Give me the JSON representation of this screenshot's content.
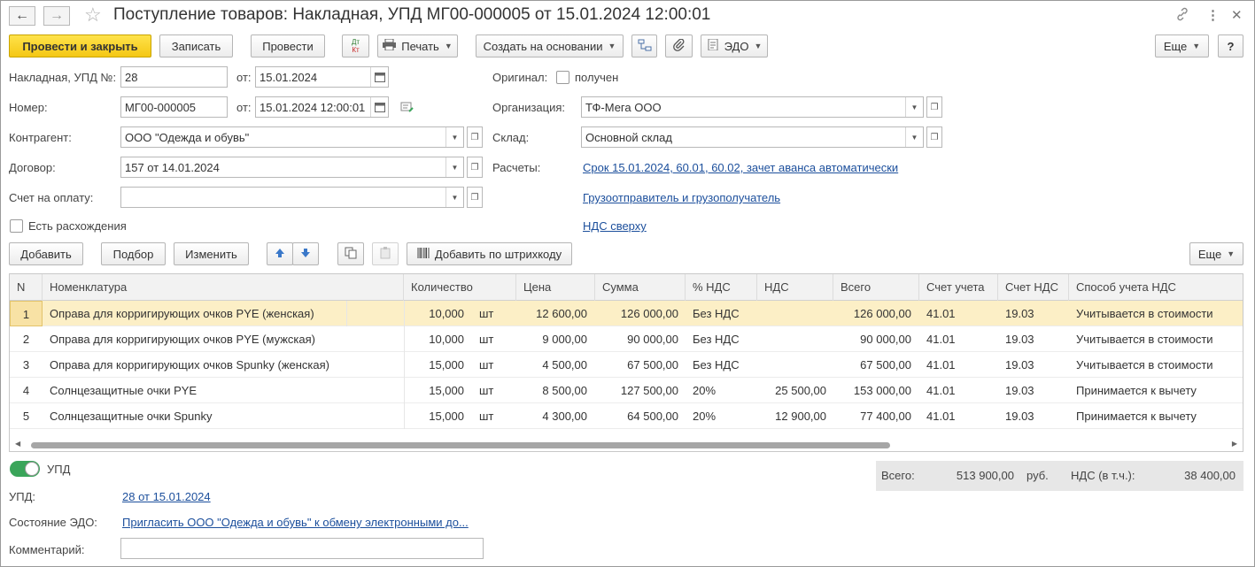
{
  "window": {
    "title": "Поступление товаров: Накладная, УПД МГ00-000005 от 15.01.2024 12:00:01"
  },
  "toolbar": {
    "post_close": "Провести и закрыть",
    "save": "Записать",
    "post": "Провести",
    "dtkt_top": "Дт",
    "dtkt_bottom": "Кт",
    "print": "Печать",
    "create_based": "Создать на основании",
    "edo": "ЭДО",
    "more": "Еще",
    "help": "?"
  },
  "form": {
    "invoice_label": "Накладная, УПД №:",
    "invoice_value": "28",
    "from_label": "от:",
    "invoice_date": "15.01.2024",
    "number_label": "Номер:",
    "number_value": "МГ00-000005",
    "number_date": "15.01.2024 12:00:01",
    "contractor_label": "Контрагент:",
    "contractor_value": "ООО \"Одежда и обувь\"",
    "contract_label": "Договор:",
    "contract_value": "157 от 14.01.2024",
    "pay_invoice_label": "Счет на оплату:",
    "pay_invoice_value": "",
    "discrepancy_label": "Есть расхождения",
    "original_label": "Оригинал:",
    "original_received": "получен",
    "org_label": "Организация:",
    "org_value": "ТФ-Мега ООО",
    "warehouse_label": "Склад:",
    "warehouse_value": "Основной склад",
    "settlements_label": "Расчеты:",
    "settlements_link": "Срок 15.01.2024, 60.01, 60.02, зачет аванса автоматически",
    "shipper_link": "Грузоотправитель и грузополучатель",
    "vat_link": "НДС сверху"
  },
  "table_toolbar": {
    "add": "Добавить",
    "pick": "Подбор",
    "change": "Изменить",
    "add_barcode": "Добавить по штрихкоду",
    "more": "Еще"
  },
  "table": {
    "headers": [
      "N",
      "Номенклатура",
      "Количество",
      "Цена",
      "Сумма",
      "% НДС",
      "НДС",
      "Всего",
      "Счет учета",
      "Счет НДС",
      "Способ учета НДС"
    ],
    "rows": [
      {
        "n": "1",
        "name": "Оправа для корригирующих очков PYE (женская)",
        "qty": "10,000",
        "unit": "шт",
        "price": "12 600,00",
        "sum": "126 000,00",
        "vat_rate": "Без НДС",
        "vat": "",
        "total": "126 000,00",
        "acc": "41.01",
        "vat_acc": "19.03",
        "vat_method": "Учитывается в стоимости"
      },
      {
        "n": "2",
        "name": "Оправа для корригирующих очков PYE (мужская)",
        "qty": "10,000",
        "unit": "шт",
        "price": "9 000,00",
        "sum": "90 000,00",
        "vat_rate": "Без НДС",
        "vat": "",
        "total": "90 000,00",
        "acc": "41.01",
        "vat_acc": "19.03",
        "vat_method": "Учитывается в стоимости"
      },
      {
        "n": "3",
        "name": "Оправа для корригирующих очков Spunky (женская)",
        "qty": "15,000",
        "unit": "шт",
        "price": "4 500,00",
        "sum": "67 500,00",
        "vat_rate": "Без НДС",
        "vat": "",
        "total": "67 500,00",
        "acc": "41.01",
        "vat_acc": "19.03",
        "vat_method": "Учитывается в стоимости"
      },
      {
        "n": "4",
        "name": "Солнцезащитные очки PYE",
        "qty": "15,000",
        "unit": "шт",
        "price": "8 500,00",
        "sum": "127 500,00",
        "vat_rate": "20%",
        "vat": "25 500,00",
        "total": "153 000,00",
        "acc": "41.01",
        "vat_acc": "19.03",
        "vat_method": "Принимается к вычету"
      },
      {
        "n": "5",
        "name": "Солнцезащитные очки Spunky",
        "qty": "15,000",
        "unit": "шт",
        "price": "4 300,00",
        "sum": "64 500,00",
        "vat_rate": "20%",
        "vat": "12 900,00",
        "total": "77 400,00",
        "acc": "41.01",
        "vat_acc": "19.03",
        "vat_method": "Принимается к вычету"
      }
    ]
  },
  "footer": {
    "upd_toggle_label": "УПД",
    "upd_label": "УПД:",
    "upd_link": "28 от 15.01.2024",
    "edo_state_label": "Состояние ЭДО:",
    "edo_state_link": "Пригласить ООО \"Одежда и обувь\" к обмену электронными до...",
    "comment_label": "Комментарий:",
    "comment_value": "",
    "total_label": "Всего:",
    "total_value": "513 900,00",
    "currency": "руб.",
    "vat_label": "НДС (в т.ч.):",
    "vat_value": "38 400,00"
  },
  "colors": {
    "primary_button": "#f4c714",
    "selected_row": "#fcefc6",
    "link": "#1c4f9c",
    "toggle_on": "#3aa55a"
  }
}
